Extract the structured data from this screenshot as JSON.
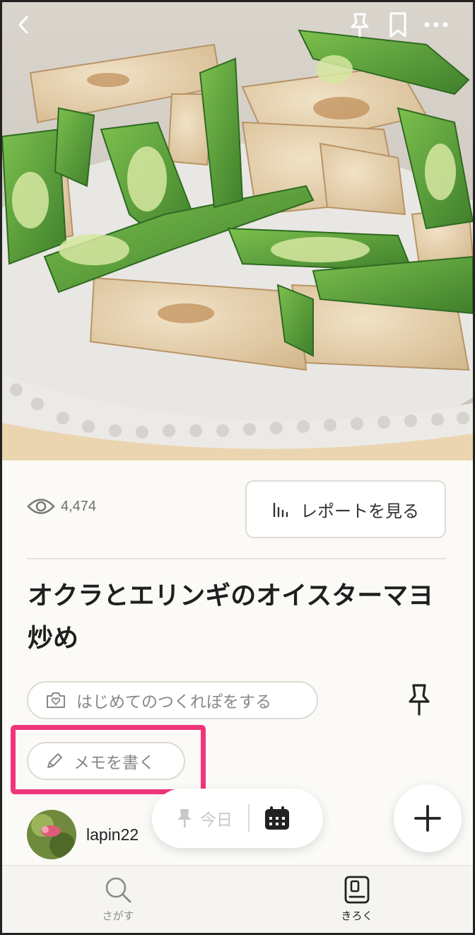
{
  "recipe": {
    "title": "オクラとエリンギのオイスターマヨ炒め",
    "views": "4,474",
    "author": "lapin22"
  },
  "actions": {
    "report_label": "レポートを見る",
    "first_tsukurepo_label": "はじめてのつくれぽをする",
    "memo_label": "メモを書く",
    "today_label": "今日"
  },
  "tabs": [
    {
      "label": "さがす",
      "active": false
    },
    {
      "label": "きろく",
      "active": true
    }
  ],
  "icons": {
    "back": "chevron-left-icon",
    "pin": "pin-icon",
    "bookmark": "bookmark-icon",
    "more": "more-dots-icon",
    "eye": "eye-icon",
    "report": "bar-chart-icon",
    "camera": "camera-heart-icon",
    "pencil": "pencil-icon",
    "calendar": "calendar-icon",
    "plus": "plus-icon",
    "search": "search-icon",
    "record": "record-book-icon"
  },
  "colors": {
    "highlight": "#f0357a",
    "okra": "#5a9a3a",
    "mushroom": "#e8d3b1"
  }
}
